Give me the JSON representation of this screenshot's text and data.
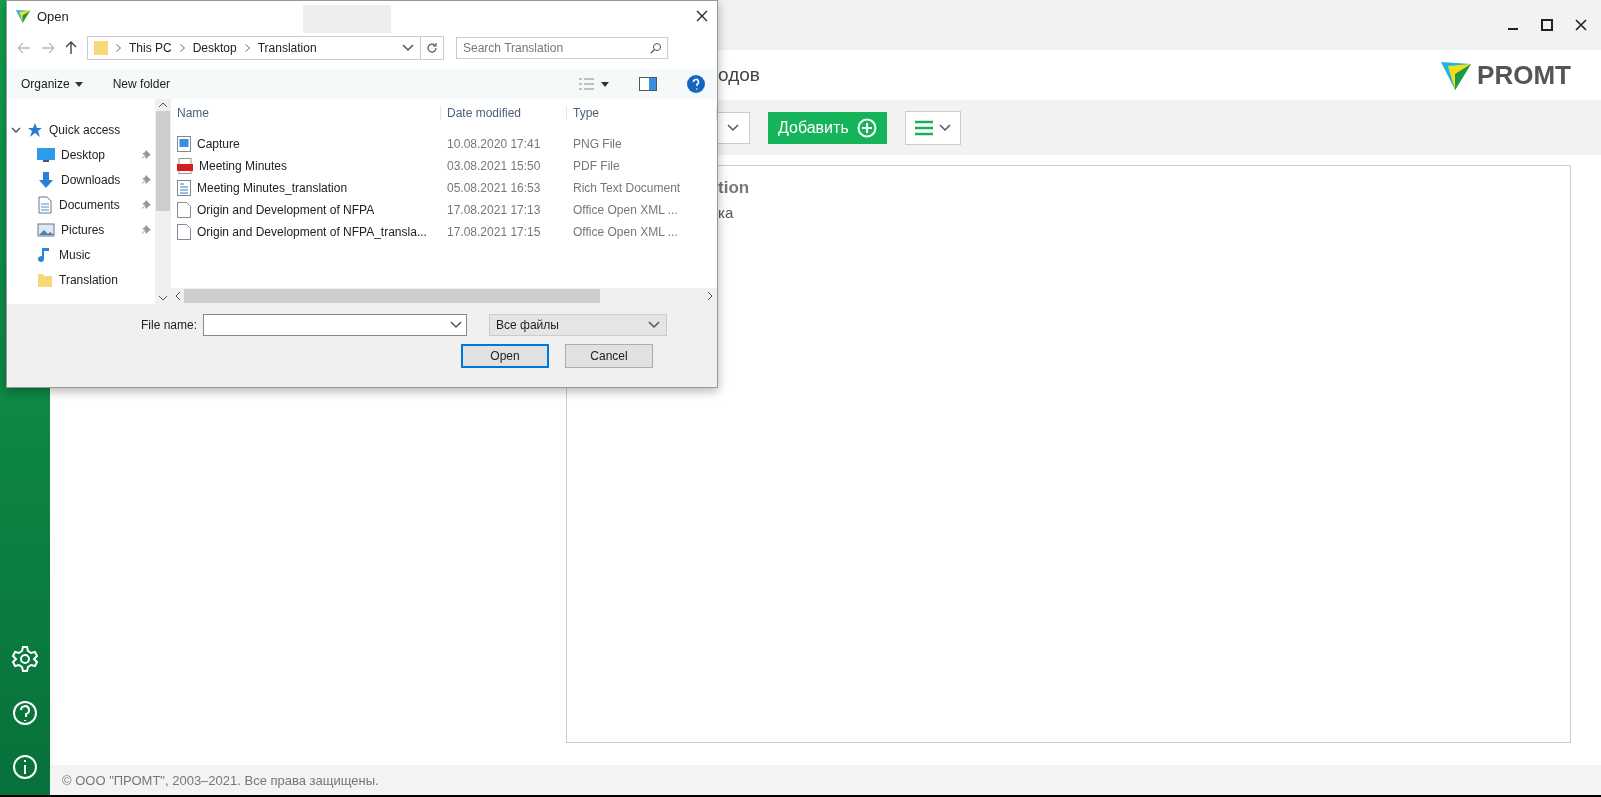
{
  "app": {
    "header_fragment": "одов",
    "logo": "PROMT",
    "add_button": "Добавить",
    "panel_title_fragment": "tion",
    "panel_subtitle_fragment": "ка",
    "footer": "© ООО \"ПРОМТ\", 2003–2021. Все права защищены."
  },
  "dialog": {
    "title": "Open",
    "breadcrumb": [
      "This PC",
      "Desktop",
      "Translation"
    ],
    "search": {
      "placeholder": "Search Translation"
    },
    "toolbar": [
      "Organize",
      "New folder"
    ],
    "nav": [
      {
        "label": "Quick access",
        "kind": "star",
        "expanded": true,
        "children": [
          {
            "label": "Desktop",
            "kind": "desktop",
            "pinned": true
          },
          {
            "label": "Downloads",
            "kind": "downloads",
            "pinned": true
          },
          {
            "label": "Documents",
            "kind": "documents",
            "pinned": true
          },
          {
            "label": "Pictures",
            "kind": "pictures",
            "pinned": true
          },
          {
            "label": "Music",
            "kind": "music",
            "pinned": false
          },
          {
            "label": "Translation",
            "kind": "folder",
            "pinned": false
          }
        ]
      }
    ],
    "columns": [
      "Name",
      "Date modified",
      "Type"
    ],
    "rows": [
      {
        "name": "Capture",
        "date": "10.08.2020 17:41",
        "type": "PNG File",
        "kind": "image"
      },
      {
        "name": "Meeting Minutes",
        "date": "03.08.2021 15:50",
        "type": "PDF File",
        "kind": "pdf"
      },
      {
        "name": "Meeting Minutes_translation",
        "date": "05.08.2021 16:53",
        "type": "Rich Text Document",
        "kind": "rtf"
      },
      {
        "name": "Origin and Development of NFPA",
        "date": "17.08.2021 17:13",
        "type": "Office Open XML ...",
        "kind": "doc"
      },
      {
        "name": "Origin and Development of NFPA_transla...",
        "date": "17.08.2021 17:15",
        "type": "Office Open XML ...",
        "kind": "doc"
      }
    ],
    "file_name_label": "File name:",
    "filter": "Все файлы",
    "buttons": [
      {
        "label": "Open",
        "default": true
      },
      {
        "label": "Cancel",
        "default": false
      }
    ]
  }
}
